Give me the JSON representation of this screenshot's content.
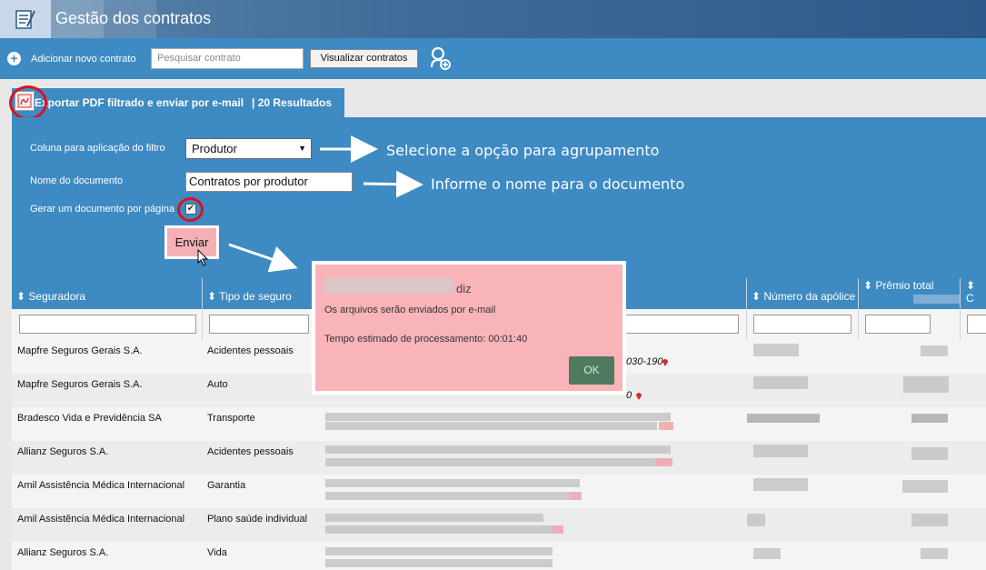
{
  "header": {
    "title": "Gestão dos contratos"
  },
  "toolbar": {
    "add_label": "Adicionar novo contrato",
    "search_placeholder": "Pesquisar contrato",
    "view_button": "Visualizar contratos"
  },
  "tab": {
    "label": "Exportar PDF filtrado e enviar por e-mail",
    "results": "| 20 Resultados"
  },
  "filter_panel": {
    "column_label": "Coluna para aplicação do filtro",
    "column_value": "Produtor",
    "doc_name_label": "Nome do documento",
    "doc_name_value": "Contratos por produtor",
    "one_per_page_label": "Gerar um documento por página",
    "one_per_page_checked": true,
    "send_button": "Enviar",
    "annotation_select": "Selecione a opção para agrupamento",
    "annotation_name": "Informe o nome para o documento"
  },
  "table": {
    "headers": [
      "Seguradora",
      "Tipo de seguro",
      "Número da apólice",
      "Prêmio total",
      "C"
    ],
    "rows": [
      {
        "seguradora": "Mapfre Seguros Gerais S.A.",
        "tipo": "Acidentes pessoais",
        "address_suffix": "030-190"
      },
      {
        "seguradora": "Mapfre Seguros Gerais S.A.",
        "tipo": "Auto",
        "address_suffix": "0"
      },
      {
        "seguradora": "Bradesco Vida e Previdência SA",
        "tipo": "Transporte"
      },
      {
        "seguradora": "Allianz Seguros S.A.",
        "tipo": "Acidentes pessoais"
      },
      {
        "seguradora": "Amil Assistência Médica Internacional",
        "tipo": "Garantia"
      },
      {
        "seguradora": "Amil Assistência Médica Internacional",
        "tipo": "Plano saúde individual"
      },
      {
        "seguradora": "Allianz Seguros S.A.",
        "tipo": "Vida"
      }
    ]
  },
  "dialog": {
    "diz": "diz",
    "message": "Os arquivos serão enviados por e-mail",
    "time_estimate": "Tempo estimado de processamento: 00:01:40",
    "ok_button": "OK"
  },
  "colors": {
    "accent": "#3e8ac3",
    "highlight_red": "#d81222",
    "dialog_bg": "#f8b4b8",
    "ok_green": "#4f7a60"
  }
}
